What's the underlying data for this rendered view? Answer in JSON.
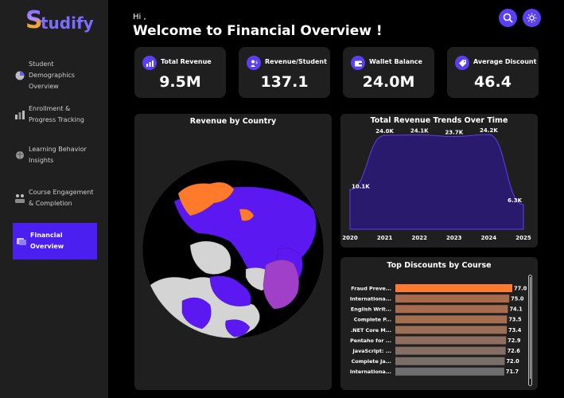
{
  "app": {
    "logo_initial": "S",
    "logo_rest": "tudify"
  },
  "sidebar": {
    "items": [
      {
        "label": "Student Demographics Overview",
        "icon": "pie-chart-icon"
      },
      {
        "label": "Enrollment & Progress Tracking",
        "icon": "bar-chart-icon"
      },
      {
        "label": "Learning Behavior Insights",
        "icon": "brain-icon"
      },
      {
        "label": "Course Engagement & Completion",
        "icon": "engagement-icon"
      },
      {
        "label": "Financial Overview",
        "icon": "finance-icon",
        "active": true
      }
    ]
  },
  "header": {
    "greeting": "Hi ,",
    "title": "Welcome to Financial Overview !"
  },
  "top_buttons": {
    "search_icon": "search-icon",
    "theme_icon": "sun-icon"
  },
  "kpis": [
    {
      "label": "Total Revenue",
      "value": "9.5M",
      "icon": "revenue-icon"
    },
    {
      "label": "Revenue/Student",
      "value": "137.1",
      "icon": "student-revenue-icon"
    },
    {
      "label": "Wallet Balance",
      "value": "24.0M",
      "icon": "wallet-icon"
    },
    {
      "label": "Average Discount",
      "value": "46.4",
      "icon": "discount-tag-icon"
    }
  ],
  "map_panel": {
    "title": "Revenue by Country"
  },
  "chart_data": [
    {
      "type": "area",
      "title": "Total Revenue Trends Over Time",
      "x": [
        "2020",
        "2021",
        "2022",
        "2023",
        "2024",
        "2025"
      ],
      "values": [
        10.1,
        24.0,
        24.1,
        23.7,
        24.2,
        6.3
      ],
      "data_labels": [
        "10.1K",
        "24.0K",
        "24.1K",
        "23.7K",
        "24.2K",
        "6.3K"
      ],
      "color": "#2a1a6e",
      "line_color": "#5b3ff2"
    },
    {
      "type": "bar",
      "orientation": "horizontal",
      "title": "Top Discounts by Course",
      "categories": [
        "Fraud Preve...",
        "Internationa...",
        "English Writ...",
        "Complete P...",
        ".NET Core M...",
        "Pentaho for ...",
        "JavaScript: ...",
        "Complete Ja...",
        "Internationa..."
      ],
      "values": [
        77.0,
        75.0,
        74.1,
        73.5,
        73.4,
        72.9,
        72.6,
        72.0,
        71.7
      ],
      "data_labels": [
        "77.0",
        "75.0",
        "74.1",
        "73.5",
        "73.4",
        "72.9",
        "72.6",
        "72.0",
        "71.7"
      ],
      "colors": [
        "#ff7a30",
        "#a86a4a",
        "#a66c4d",
        "#a46e50",
        "#9b6e56",
        "#8e6e5e",
        "#856e63",
        "#7a6e68",
        "#6e6e6e"
      ],
      "xlim": [
        0,
        77
      ]
    }
  ]
}
